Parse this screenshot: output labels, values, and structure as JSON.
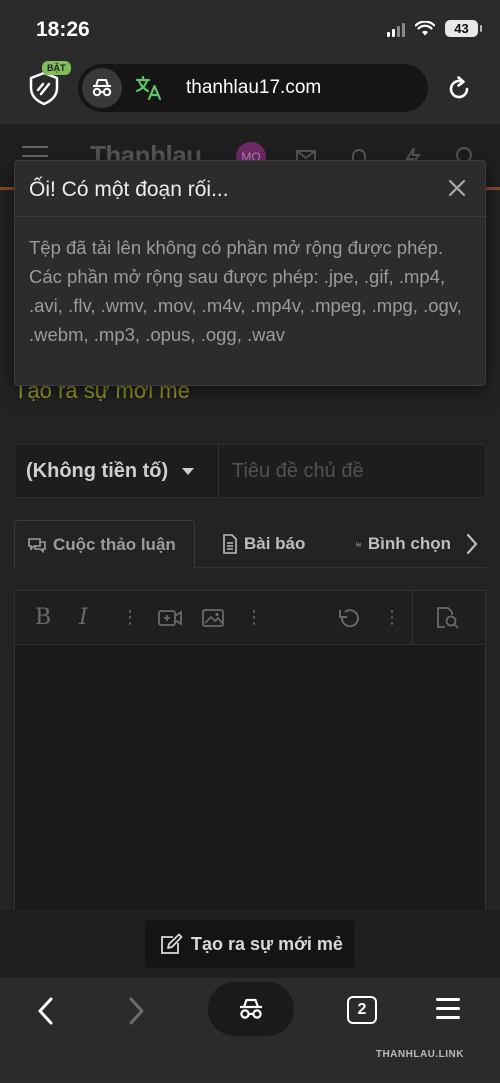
{
  "status_bar": {
    "time": "18:26",
    "battery": "43"
  },
  "browser": {
    "shield_badge": "BẬT",
    "url": "thanhlau17.com",
    "tab_count": "2"
  },
  "site_header": {
    "logo_text": "Thanhlau",
    "avatar_text": "MO"
  },
  "popup": {
    "title": "Ối! Có một đoạn rối...",
    "message": "Tệp đã tải lên không có phần mở rộng được phép. Các phần mở rộng sau được phép: .jpe, .gif, .mp4, .avi, .flv, .wmv, .mov, .m4v, .mp4v, .mpeg, .mpg, .ogv, .webm, .mp3, .opus, .ogg, .wav"
  },
  "page": {
    "title": "Tạo ra sự mới mẻ"
  },
  "form": {
    "prefix_label": "(Không tiền tố)",
    "title_placeholder": "Tiêu đề chủ đề"
  },
  "tabs": [
    {
      "label": "Cuộc thảo luận",
      "icon": "comments-icon"
    },
    {
      "label": "Bài báo",
      "icon": "article-icon"
    },
    {
      "label": "Bình chọn",
      "icon": "poll-icon"
    }
  ],
  "editor": {
    "tools": [
      "bold-icon",
      "italic-icon",
      "more-icon",
      "video-icon",
      "image-icon",
      "more-icon",
      "undo-icon",
      "more-icon",
      "preview-icon"
    ]
  },
  "submit": {
    "label": "Tạo ra sự mới mẻ"
  },
  "watermark": "THANHLAU.LINK"
}
